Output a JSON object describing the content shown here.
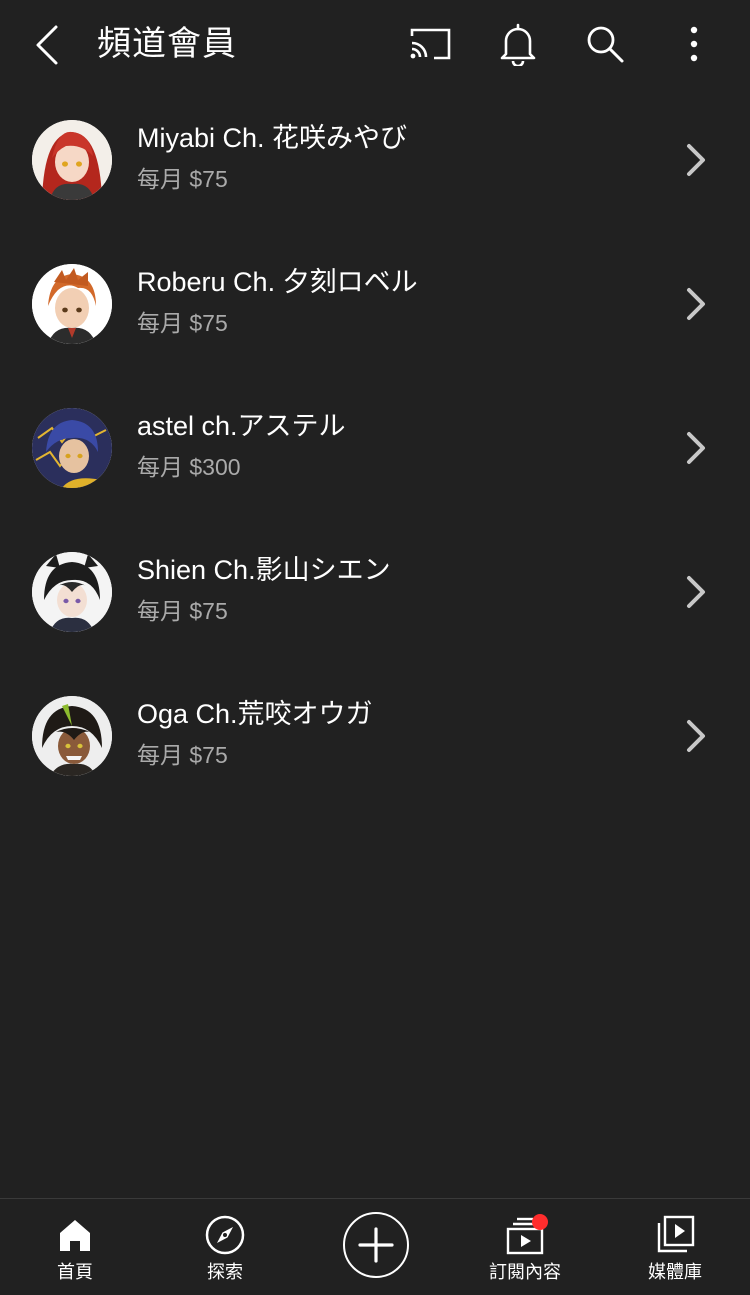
{
  "header": {
    "title": "頻道會員",
    "icons": {
      "back": "back-arrow-icon",
      "cast": "cast-icon",
      "notifications": "bell-icon",
      "search": "search-icon",
      "more": "more-vert-icon"
    }
  },
  "memberships": [
    {
      "name": "Miyabi Ch. 花咲みやび",
      "price": "每月 $75"
    },
    {
      "name": "Roberu Ch. 夕刻ロベル",
      "price": "每月 $75"
    },
    {
      "name": "astel ch.アステル",
      "price": "每月 $300"
    },
    {
      "name": "Shien Ch.影山シエン",
      "price": "每月 $75"
    },
    {
      "name": "Oga Ch.荒咬オウガ",
      "price": "每月 $75"
    }
  ],
  "bottom_nav": {
    "home": "首頁",
    "explore": "探索",
    "subscriptions": "訂閱內容",
    "library": "媒體庫"
  },
  "colors": {
    "background": "#212121",
    "text_primary": "#ffffff",
    "text_secondary": "#aaaaaa",
    "notification_dot": "#ff2d2d"
  }
}
